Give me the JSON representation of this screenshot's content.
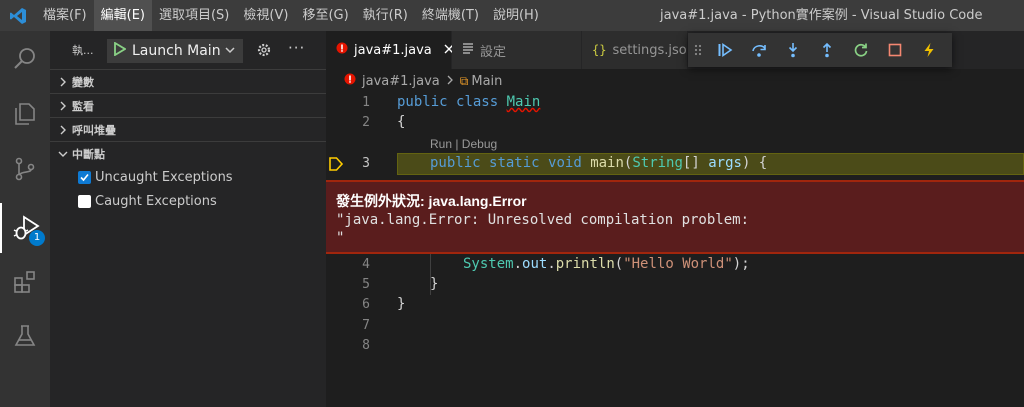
{
  "titlebar": {
    "menu": [
      "檔案(F)",
      "編輯(E)",
      "選取項目(S)",
      "檢視(V)",
      "移至(G)",
      "執行(R)",
      "終端機(T)",
      "說明(H)"
    ],
    "window_title": "java#1.java - Python實作案例 - Visual Studio Code"
  },
  "activity": {
    "icons": [
      "explorer-icon",
      "search-icon",
      "source-control-icon",
      "run-debug-icon",
      "extensions-icon",
      "testing-icon"
    ],
    "debug_badge": "1"
  },
  "sidebar": {
    "header_abbr": "執...",
    "launch_config": "Launch Main",
    "sections": {
      "variables": "變數",
      "watch": "監看",
      "call_stack": "呼叫堆疊",
      "breakpoints": "中斷點"
    },
    "breakpoints": [
      {
        "label": "Uncaught Exceptions",
        "checked": true
      },
      {
        "label": "Caught Exceptions",
        "checked": false
      }
    ]
  },
  "tabs": [
    {
      "label": "java#1.java",
      "active": true,
      "icon": "java-error-icon"
    },
    {
      "label": "設定",
      "active": false,
      "icon": "settings-list-icon"
    },
    {
      "label": "settings.jso",
      "active": false,
      "icon": "json-braces-icon"
    }
  ],
  "debug_toolbar": [
    "continue-icon",
    "step-over-icon",
    "step-into-icon",
    "step-out-icon",
    "restart-icon",
    "stop-icon",
    "hot-code-replace-icon"
  ],
  "breadcrumb": {
    "file": "java#1.java",
    "symbol": "Main"
  },
  "editor": {
    "line_numbers": [
      "1",
      "2",
      "3",
      "4",
      "5",
      "6",
      "7",
      "8"
    ],
    "codelens": "Run | Debug",
    "lines": {
      "l1": {
        "kw1": "public",
        "kw2": "class",
        "name": "Main"
      },
      "l2": {
        "text": "{"
      },
      "l3": {
        "kw1": "public",
        "kw2": "static",
        "kw3": "void",
        "fn": "main",
        "open": "(",
        "type": "String",
        "rest": "[] ",
        "param": "args",
        "close": ") {"
      },
      "l4": {
        "obj": "System",
        "dot1": ".",
        "field": "out",
        "dot2": ".",
        "fn": "println",
        "open": "(",
        "str": "\"Hello World\"",
        "close": ");"
      },
      "l5": {
        "text": "}"
      },
      "l6": {
        "text": "}"
      }
    }
  },
  "exception": {
    "title": "發生例外狀況: java.lang.Error",
    "message": "\"java.lang.Error: Unresolved compilation problem:\n\""
  },
  "colors": {
    "accent": "#007acc",
    "exception_bg": "#5a1d1d",
    "current_line": "#4b4b18"
  }
}
